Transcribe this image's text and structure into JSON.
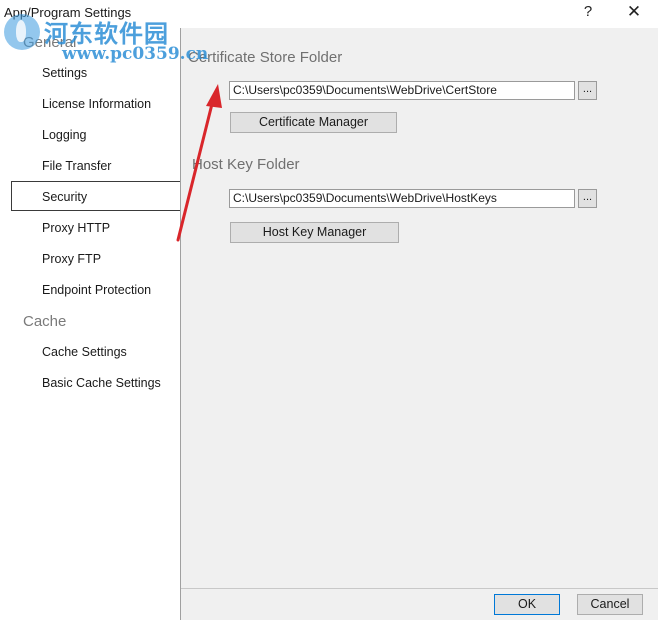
{
  "window": {
    "title": "App/Program Settings",
    "help_label": "?",
    "close_label": "✕"
  },
  "watermark": {
    "brand": "河东软件园",
    "url": "www.pc0359.cn"
  },
  "sidebar": {
    "group_general": "General",
    "group_cache": "Cache",
    "items": [
      {
        "label": "Settings"
      },
      {
        "label": "License Information"
      },
      {
        "label": "Logging"
      },
      {
        "label": "File Transfer"
      },
      {
        "label": "Security"
      },
      {
        "label": "Proxy HTTP"
      },
      {
        "label": "Proxy FTP"
      },
      {
        "label": "Endpoint Protection"
      },
      {
        "label": "Cache Settings"
      },
      {
        "label": "Basic Cache Settings"
      }
    ],
    "selected": "Security"
  },
  "main": {
    "cert_section_title": "Certificate Store Folder",
    "cert_path": "C:\\Users\\pc0359\\Documents\\WebDrive\\CertStore",
    "cert_browse_label": "...",
    "cert_manager_label": "Certificate Manager",
    "hostkey_section_title": "Host Key Folder",
    "hostkey_path": "C:\\Users\\pc0359\\Documents\\WebDrive\\HostKeys",
    "hostkey_browse_label": "...",
    "hostkey_manager_label": "Host Key Manager"
  },
  "footer": {
    "ok_label": "OK",
    "cancel_label": "Cancel"
  },
  "colors": {
    "annotation_arrow": "#d9262b",
    "watermark": "#2d8fd6",
    "ok_border": "#0078d7"
  }
}
